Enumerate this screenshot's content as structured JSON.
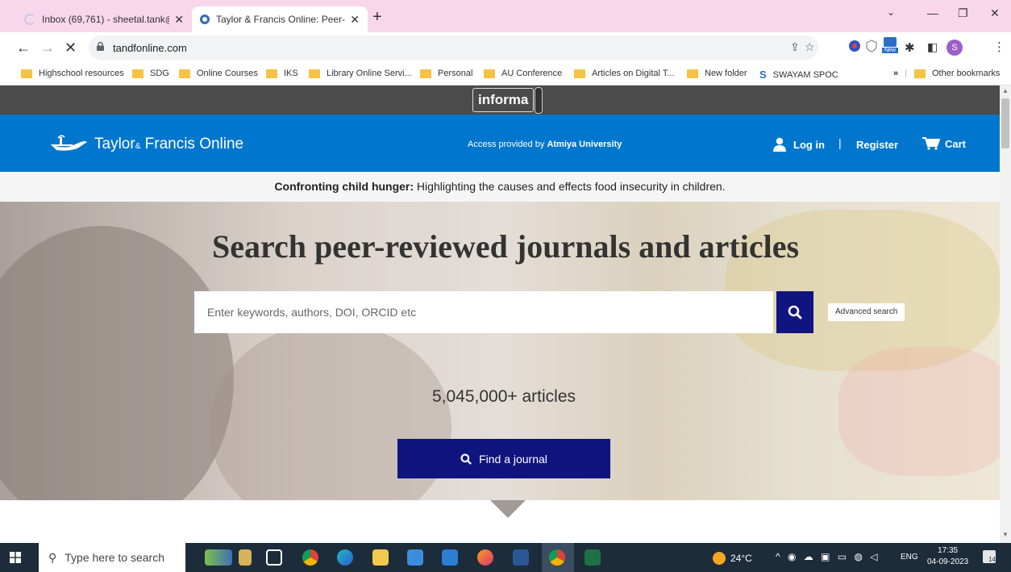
{
  "browser": {
    "tabs": [
      {
        "title": "Inbox (69,761) - sheetal.tank@atr",
        "active": false
      },
      {
        "title": "Taylor & Francis Online: Peer-revi",
        "active": true
      }
    ],
    "new_tab": "+",
    "address": "tandfonline.com",
    "profile_initial": "S",
    "ext_badge": "New",
    "bookmarks": [
      "Highschool resources",
      "SDG",
      "Online Courses",
      "IKS",
      "Library Online Servi...",
      "Personal",
      "AU Conference",
      "Articles on Digital T...",
      "New folder",
      "SWAYAM SPOC"
    ],
    "more_bookmarks": "»",
    "other_bookmarks": "Other bookmarks"
  },
  "informa": {
    "logo": "informa"
  },
  "header": {
    "brand_taylor": "Taylor",
    "brand_amp": "&",
    "brand_francis": " Francis Online",
    "access_prefix": "Access provided by ",
    "access_institution": "Atmiya University",
    "login": "Log in",
    "separator": "|",
    "register": "Register",
    "cart": "Cart"
  },
  "banner": {
    "bold": "Confronting child hunger:",
    "text": " Highlighting the causes and effects food insecurity in children."
  },
  "hero": {
    "title": "Search peer-reviewed journals and articles",
    "search_placeholder": "Enter keywords, authors, DOI, ORCID etc",
    "advanced_search": "Advanced search",
    "article_count": "5,045,000+ articles",
    "find_journal": "Find a journal"
  },
  "taskbar": {
    "search_placeholder": "Type here to search",
    "temperature": "24°C",
    "language": "ENG",
    "time": "17:35",
    "date": "04-09-2023",
    "notification_count": "14"
  },
  "colors": {
    "tf_blue": "#0077cc",
    "button_navy": "#10147e",
    "informa_bar": "#4b4b4b",
    "tabstrip_pink": "#f9d7ea"
  }
}
